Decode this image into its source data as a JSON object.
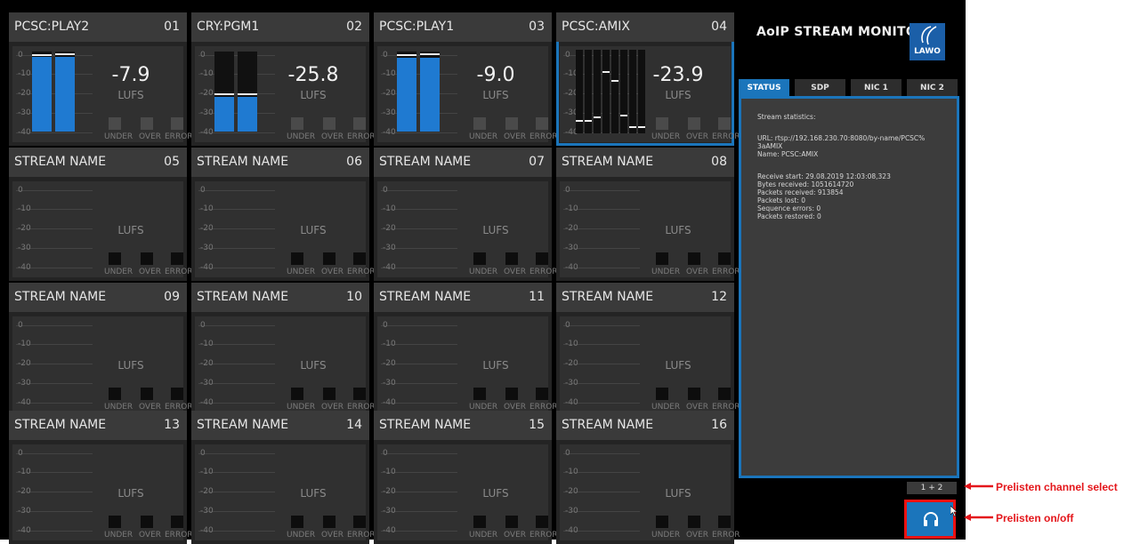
{
  "app": {
    "title": "AoIP STREAM MONITOR",
    "logo_text": "LAWO"
  },
  "tabs": [
    {
      "label": "STATUS",
      "active": true
    },
    {
      "label": "SDP",
      "active": false
    },
    {
      "label": "NIC 1",
      "active": false
    },
    {
      "label": "NIC 2",
      "active": false
    }
  ],
  "scale": [
    "0",
    "-10",
    "-20",
    "-30",
    "-40"
  ],
  "indicators": [
    "UNDER",
    "OVER",
    "ERROR"
  ],
  "unit": "LUFS",
  "tiles": [
    {
      "name": "PCSC:PLAY2",
      "number": "01",
      "value": "-7.9",
      "meter": "stereo",
      "levels": [
        0.93,
        0.93
      ],
      "peaks": [
        0.95,
        0.96
      ],
      "selected": false
    },
    {
      "name": "CRY:PGM1",
      "number": "02",
      "value": "-25.8",
      "meter": "stereo",
      "levels": [
        0.43,
        0.43
      ],
      "peaks": [
        0.46,
        0.46
      ],
      "selected": false
    },
    {
      "name": "PCSC:PLAY1",
      "number": "03",
      "value": "-9.0",
      "meter": "stereo",
      "levels": [
        0.92,
        0.92
      ],
      "peaks": [
        0.94,
        0.96
      ],
      "selected": false
    },
    {
      "name": "PCSC:AMIX",
      "number": "04",
      "value": "-23.9",
      "meter": "multi",
      "levels": [
        0,
        0,
        0,
        0,
        0.6,
        0,
        0,
        0
      ],
      "peaks": [
        0.14,
        0.14,
        0.18,
        0.72,
        0.62,
        0.2,
        0.06,
        0.06
      ],
      "selected": true
    },
    {
      "name": "STREAM NAME",
      "number": "05",
      "value": "",
      "meter": "none"
    },
    {
      "name": "STREAM NAME",
      "number": "06",
      "value": "",
      "meter": "none"
    },
    {
      "name": "STREAM NAME",
      "number": "07",
      "value": "",
      "meter": "none"
    },
    {
      "name": "STREAM NAME",
      "number": "08",
      "value": "",
      "meter": "none"
    },
    {
      "name": "STREAM NAME",
      "number": "09",
      "value": "",
      "meter": "none"
    },
    {
      "name": "STREAM NAME",
      "number": "10",
      "value": "",
      "meter": "none"
    },
    {
      "name": "STREAM NAME",
      "number": "11",
      "value": "",
      "meter": "none"
    },
    {
      "name": "STREAM NAME",
      "number": "12",
      "value": "",
      "meter": "none"
    },
    {
      "name": "STREAM NAME",
      "number": "13",
      "value": "",
      "meter": "none"
    },
    {
      "name": "STREAM NAME",
      "number": "14",
      "value": "",
      "meter": "none"
    },
    {
      "name": "STREAM NAME",
      "number": "15",
      "value": "",
      "meter": "none"
    },
    {
      "name": "STREAM NAME",
      "number": "16",
      "value": "",
      "meter": "none"
    }
  ],
  "status": {
    "heading": "Stream statistics:",
    "url_line1": "URL: rtsp://192.168.230.70:8080/by-name/PCSC%",
    "url_line2": "3aAMIX",
    "name": "Name: PCSC:AMIX",
    "receive_start": "Receive start: 29.08.2019 12:03:08,323",
    "bytes_received": "Bytes received: 1051614720",
    "packets_received": "Packets received: 913854",
    "packets_lost": "Packets lost: 0",
    "sequence_errors": "Sequence errors: 0",
    "packets_restored": "Packets restored: 0"
  },
  "prelisten": {
    "channel_select": "1 + 2",
    "icon": "headphone-icon"
  },
  "annotations": {
    "channel_select": "Prelisten channel select",
    "on_off": "Prelisten on/off",
    "color": "#e4161b"
  },
  "colors": {
    "accent": "#1b75bb",
    "meter_fill": "#1f7ad1"
  }
}
